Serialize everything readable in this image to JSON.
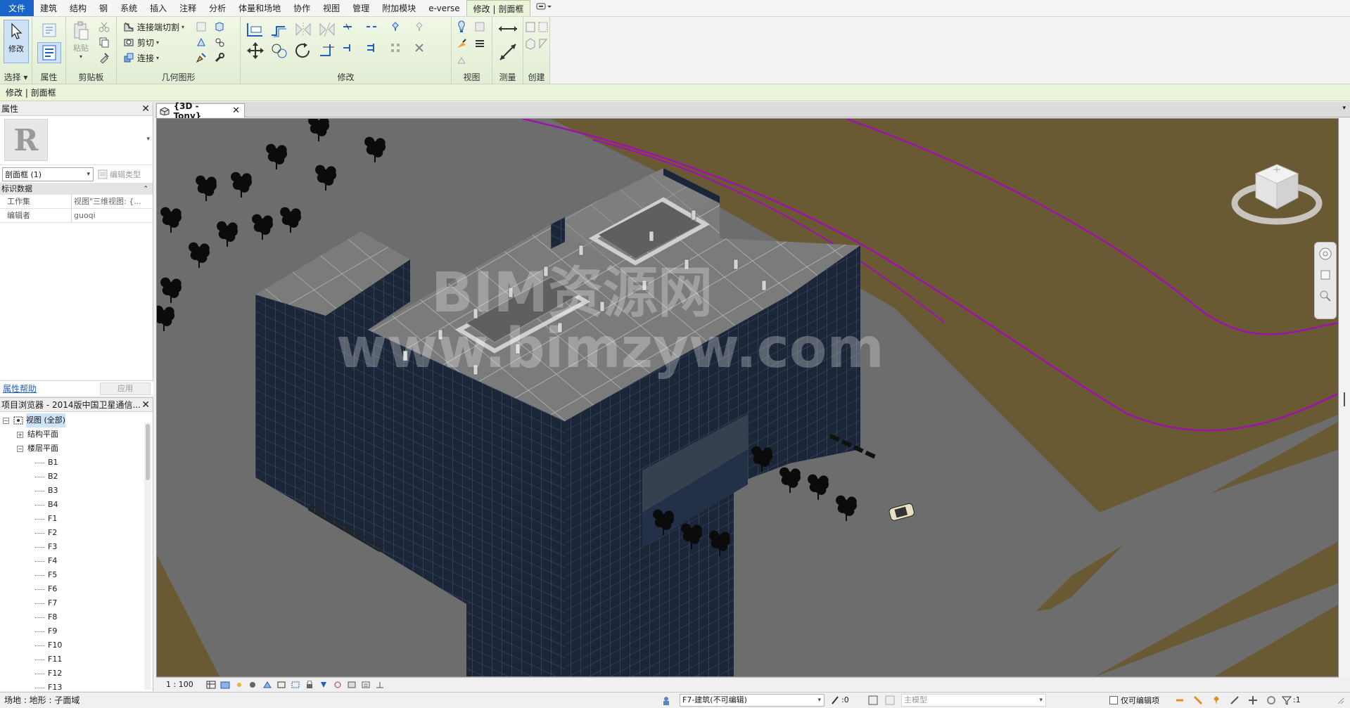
{
  "menu": {
    "file": "文件",
    "tabs": [
      "建筑",
      "结构",
      "钢",
      "系统",
      "插入",
      "注释",
      "分析",
      "体量和场地",
      "协作",
      "视图",
      "管理",
      "附加模块",
      "e-verse"
    ],
    "active_tab": "修改 | 剖面框"
  },
  "ribbon": {
    "select": {
      "button": "修改",
      "label": "选择"
    },
    "properties": {
      "label": "属性"
    },
    "clipboard": {
      "paste": "粘贴",
      "label": "剪贴板"
    },
    "geometry": {
      "cope": "连接端切割",
      "cut": "剪切",
      "join": "连接",
      "label": "几何图形"
    },
    "modify": {
      "label": "修改"
    },
    "view": {
      "label": "视图"
    },
    "measure": {
      "label": "测量"
    },
    "create": {
      "label": "创建"
    }
  },
  "context_bar": {
    "text": "修改 | 剖面框"
  },
  "properties_palette": {
    "title": "属性",
    "logo_letter": "R",
    "instance_selector": "剖面框 (1)",
    "edit_type": "编辑类型",
    "group": "标识数据",
    "rows": [
      {
        "name": "工作集",
        "value": "视图\"三维视图: {..."
      },
      {
        "name": "编辑者",
        "value": "guoqi"
      }
    ],
    "help_link": "属性帮助",
    "apply": "应用"
  },
  "project_browser": {
    "title": "项目浏览器 - 2014版中国卫星通信...",
    "root": "视图 (全部)",
    "structural_plans": "结构平面",
    "floor_plans": "楼层平面",
    "levels": [
      "B1",
      "B2",
      "B3",
      "B4",
      "F1",
      "F2",
      "F3",
      "F4",
      "F5",
      "F6",
      "F7",
      "F8",
      "F9",
      "F10",
      "F11",
      "F12",
      "F13"
    ]
  },
  "view_tab": {
    "label": "{3D - Tony}"
  },
  "watermark": {
    "line1": "BIM资源网",
    "line2": "www.bimzyw.com"
  },
  "view_control_bar": {
    "scale": "1 : 100"
  },
  "status_bar": {
    "text": "场地 : 地形 : 子面域",
    "selection_count": ":0",
    "workset": "F7-建筑(不可编辑)",
    "design_option": "主模型",
    "editable_only": "仅可编辑项",
    "filter_count": ":1"
  },
  "colors": {
    "file_tab": "#1864c8",
    "context_tint": "#e9f4d9",
    "site_ground": "#6b5a32",
    "section_line": "#a20fb0",
    "facade": "#1d2838",
    "roof": "#7a7a7a"
  }
}
